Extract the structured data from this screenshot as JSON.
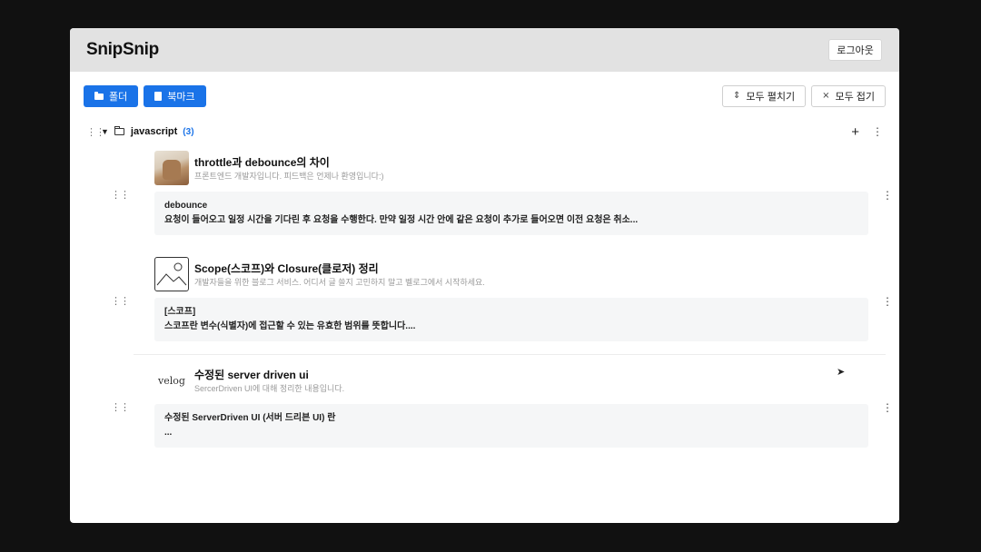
{
  "app": {
    "brand": "SnipSnip",
    "logout_label": "로그아웃"
  },
  "toolbar": {
    "folder_label": "폴더",
    "bookmark_label": "북마크",
    "expand_all_label": "모두 펼치기",
    "collapse_all_label": "모두 접기"
  },
  "folder": {
    "name": "javascript",
    "count": "(3)"
  },
  "bookmarks": [
    {
      "title": "throttle과 debounce의 차이",
      "subtitle": "프론트엔드 개발자입니다. 피드백은 언제나 환영입니다:)",
      "snippet_heading": "debounce",
      "snippet_body": "요청이 들어오고 일정 시간을 기다린 후 요청을 수행한다. 만약 일정 시간 안에 같은 요청이 추가로 들어오면 이전 요청은 취소..."
    },
    {
      "title": "Scope(스코프)와 Closure(클로저) 정리",
      "subtitle": "개발자들을 위한 블로그 서비스. 어디서 글 쓸지 고민하지 말고 벨로그에서 시작하세요.",
      "snippet_heading": "[스코프]",
      "snippet_body": "스코프란 변수(식별자)에 접근할 수 있는 유효한 범위를 뜻합니다...."
    },
    {
      "title": "수정된 server driven ui",
      "subtitle": "SercerDriven UI에 대해 정리한 내용입니다.",
      "thumb_text": "velog",
      "snippet_heading": "수정된 ServerDriven UI (서버 드리븐 UI) 란",
      "snippet_body": "..."
    }
  ],
  "colors": {
    "primary": "#1a73e8",
    "topbar": "#e2e2e2",
    "backdrop": "#111111",
    "snippet_bg": "#f5f6f7"
  }
}
